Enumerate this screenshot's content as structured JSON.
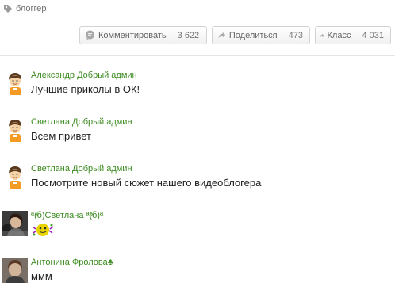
{
  "tag": {
    "label": "блоггер",
    "icon": "tag-icon"
  },
  "actions": {
    "comment": {
      "label": "Комментировать",
      "count": "3 622",
      "icon": "comment-bubble-icon"
    },
    "share": {
      "label": "Поделиться",
      "count": "473",
      "icon": "share-arrow-icon"
    },
    "like": {
      "label": "Класс",
      "count": "4 031",
      "icon": "thumbs-up-icon"
    }
  },
  "comments": [
    {
      "author": "Александр Добрый админ",
      "text": "Лучшие приколы в ОК!",
      "avatar": "cartoon-avatar"
    },
    {
      "author": "Светлана Добрый админ",
      "text": "Всем привет",
      "avatar": "cartoon-avatar"
    },
    {
      "author": "Светлана Добрый админ",
      "text": "Посмотрите новый сюжет нашего видеоблогера",
      "avatar": "cartoon-avatar"
    },
    {
      "author": "ª(ͯ͡o)Светлана ª(ͯ͡o)ª",
      "text": "",
      "avatar": "photo-avatar",
      "sticker": "smiley-sticker"
    },
    {
      "author": "Антонина Фролова♣",
      "text": "ммм",
      "avatar": "photo-avatar"
    }
  ],
  "colors": {
    "author": "#3b8a1f",
    "accent": "#f5a623"
  }
}
